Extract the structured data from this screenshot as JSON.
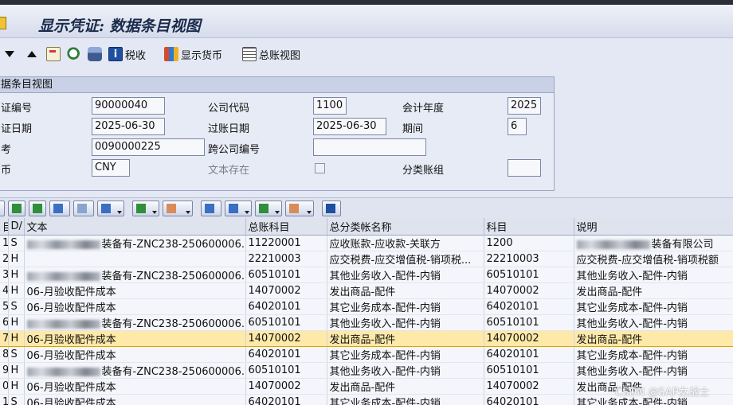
{
  "window": {
    "title": "显示凭证: 数据条目视图"
  },
  "toolbar": {
    "tax_label": "税收",
    "currency_label": "显示货币",
    "gl_view_label": "总账视图"
  },
  "header": {
    "group_title": "据条目视图",
    "doc_no_label": "证编号",
    "doc_no": "90000040",
    "company_code_label": "公司代码",
    "company_code": "1100",
    "fiscal_year_label": "会计年度",
    "fiscal_year": "2025",
    "doc_date_label": "证日期",
    "doc_date": "2025-06-30",
    "posting_date_label": "过账日期",
    "posting_date": "2025-06-30",
    "period_label": "期间",
    "period": "6",
    "reference_label": "考",
    "reference": "0090000225",
    "cross_company_label": "跨公司编号",
    "cross_company": "",
    "currency_label": "币",
    "currency": "CNY",
    "text_exists_label": "文本存在",
    "ledger_group_label": "分类账组",
    "ledger_group": ""
  },
  "table": {
    "columns": [
      "目",
      "D/",
      "文本",
      "总账科目",
      "总分类帐名称",
      "科目",
      "说明"
    ],
    "rows": [
      {
        "item": "1",
        "dc": "S",
        "text": "装备有-ZNC238-250600006...",
        "gl": "11220001",
        "gl_name": "应收账款-应收款-关联方",
        "account": "1200",
        "desc": "装备有限公司",
        "blur_text": true,
        "blur_desc": true
      },
      {
        "item": "2",
        "dc": "H",
        "text": "",
        "gl": "22210003",
        "gl_name": "应交税费-应交增值税-销项税...",
        "account": "22210003",
        "desc": "应交税费-应交增值税-销项税额"
      },
      {
        "item": "3",
        "dc": "H",
        "text": "装备有-ZNC238-250600006...",
        "gl": "60510101",
        "gl_name": "其他业务收入-配件-内销",
        "account": "60510101",
        "desc": "其他业务收入-配件-内销",
        "blur_text": true
      },
      {
        "item": "4",
        "dc": "H",
        "text": "06-月验收配件成本",
        "gl": "14070002",
        "gl_name": "发出商品-配件",
        "account": "14070002",
        "desc": "发出商品-配件"
      },
      {
        "item": "5",
        "dc": "S",
        "text": "06-月验收配件成本",
        "gl": "64020101",
        "gl_name": "其它业务成本-配件-内销",
        "account": "64020101",
        "desc": "其它业务成本-配件-内销"
      },
      {
        "item": "6",
        "dc": "H",
        "text": "装备有-ZNC238-250600006...",
        "gl": "60510101",
        "gl_name": "其他业务收入-配件-内销",
        "account": "60510101",
        "desc": "其他业务收入-配件-内销",
        "blur_text": true
      },
      {
        "item": "7",
        "dc": "H",
        "text": "06-月验收配件成本",
        "gl": "14070002",
        "gl_name": "发出商品-配件",
        "account": "14070002",
        "desc": "发出商品-配件",
        "selected": true
      },
      {
        "item": "8",
        "dc": "S",
        "text": "06-月验收配件成本",
        "gl": "64020101",
        "gl_name": "其它业务成本-配件-内销",
        "account": "64020101",
        "desc": "其它业务成本-配件-内销"
      },
      {
        "item": "9",
        "dc": "H",
        "text": "装备有-ZNC238-250600006...",
        "gl": "60510101",
        "gl_name": "其他业务收入-配件-内销",
        "account": "60510101",
        "desc": "其他业务收入-配件-内销",
        "blur_text": true
      },
      {
        "item": "0",
        "dc": "H",
        "text": "06-月验收配件成本",
        "gl": "14070002",
        "gl_name": "发出商品-配件",
        "account": "14070002",
        "desc": "发出商品-配件"
      },
      {
        "item": "1",
        "dc": "S",
        "text": "06-月验收配件成本",
        "gl": "64020101",
        "gl_name": "其它业务成本-配件-内销",
        "account": "64020101",
        "desc": "其它业务成本-配件-内销"
      }
    ]
  },
  "watermark": "CSDN @SAP女战士",
  "colors": {
    "selected_row": "#ffe9a8",
    "background": "#e4e8f4"
  }
}
